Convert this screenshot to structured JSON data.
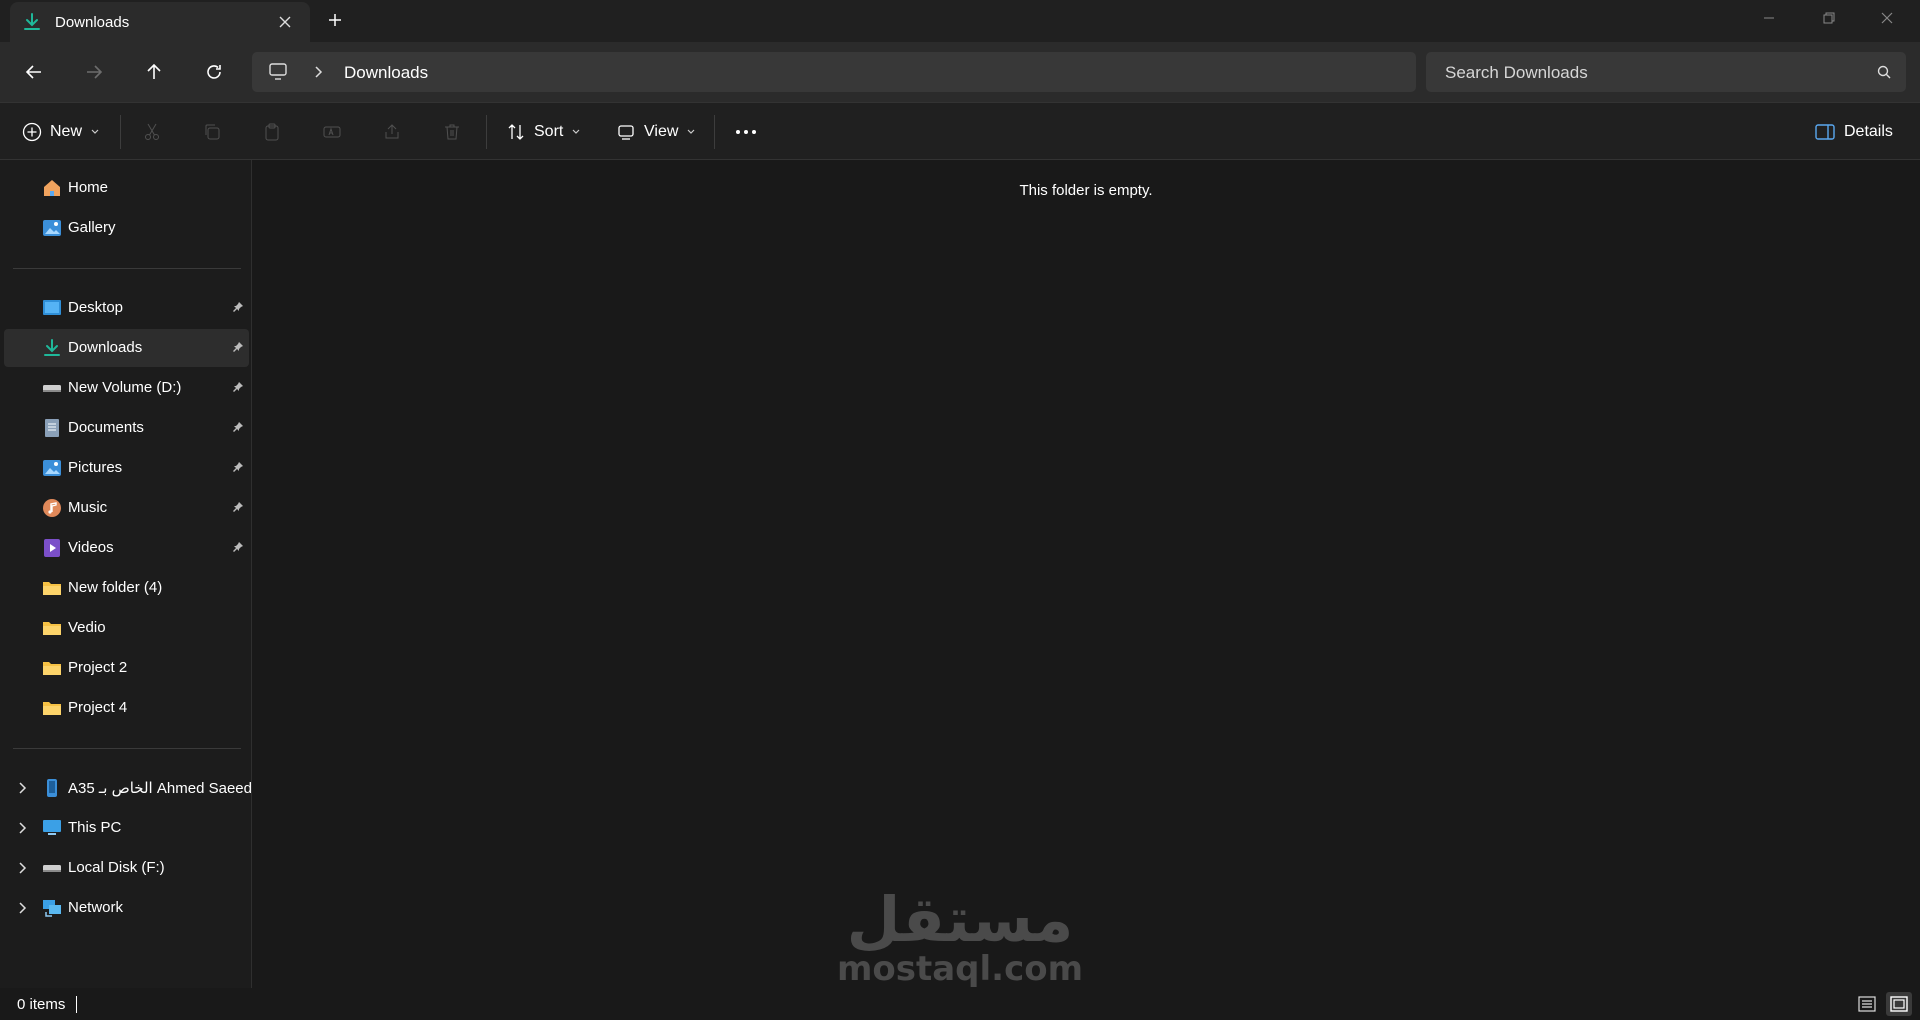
{
  "window": {
    "tab_title": "Downloads",
    "tab_icon": "download-icon",
    "controls": [
      "minimize-icon",
      "restore-icon",
      "close-icon"
    ]
  },
  "address": {
    "crumbs": [
      "Downloads"
    ],
    "search_placeholder": "Search Downloads"
  },
  "commands": {
    "new_label": "New",
    "sort_label": "Sort",
    "view_label": "View",
    "details_label": "Details",
    "disabled": [
      "cut-icon",
      "copy-icon",
      "paste-icon",
      "rename-icon",
      "share-icon",
      "delete-icon"
    ]
  },
  "sidebar": {
    "top": [
      {
        "label": "Home",
        "icon": "home-icon"
      },
      {
        "label": "Gallery",
        "icon": "gallery-icon"
      }
    ],
    "quick_access": [
      {
        "label": "Desktop",
        "icon": "desktop-icon",
        "pinned": true
      },
      {
        "label": "Downloads",
        "icon": "download-icon",
        "pinned": true,
        "selected": true
      },
      {
        "label": "New Volume (D:)",
        "icon": "drive-icon",
        "pinned": true
      },
      {
        "label": "Documents",
        "icon": "documents-icon",
        "pinned": true
      },
      {
        "label": "Pictures",
        "icon": "pictures-icon",
        "pinned": true
      },
      {
        "label": "Music",
        "icon": "music-icon",
        "pinned": true
      },
      {
        "label": "Videos",
        "icon": "videos-icon",
        "pinned": true
      },
      {
        "label": "New folder (4)",
        "icon": "folder-icon",
        "pinned": false
      },
      {
        "label": "Vedio",
        "icon": "folder-icon",
        "pinned": false
      },
      {
        "label": "Project 2",
        "icon": "folder-icon",
        "pinned": false
      },
      {
        "label": "Project 4",
        "icon": "folder-icon",
        "pinned": false
      }
    ],
    "devices": [
      {
        "label": "A35 الخاص بـ Ahmed Saeed",
        "icon": "phone-icon"
      },
      {
        "label": "This PC",
        "icon": "this-pc-icon"
      },
      {
        "label": "Local Disk (F:)",
        "icon": "drive-icon"
      },
      {
        "label": "Network",
        "icon": "network-icon"
      }
    ]
  },
  "content": {
    "empty_message": "This folder is empty."
  },
  "watermark": {
    "arabic": "مستقل",
    "latin": "mostaql.com"
  },
  "status": {
    "item_count": "0 items"
  },
  "colors": {
    "accent_download": "#1fb89a",
    "folder": "#f6c144",
    "accent_blue": "#5aa8f0"
  }
}
